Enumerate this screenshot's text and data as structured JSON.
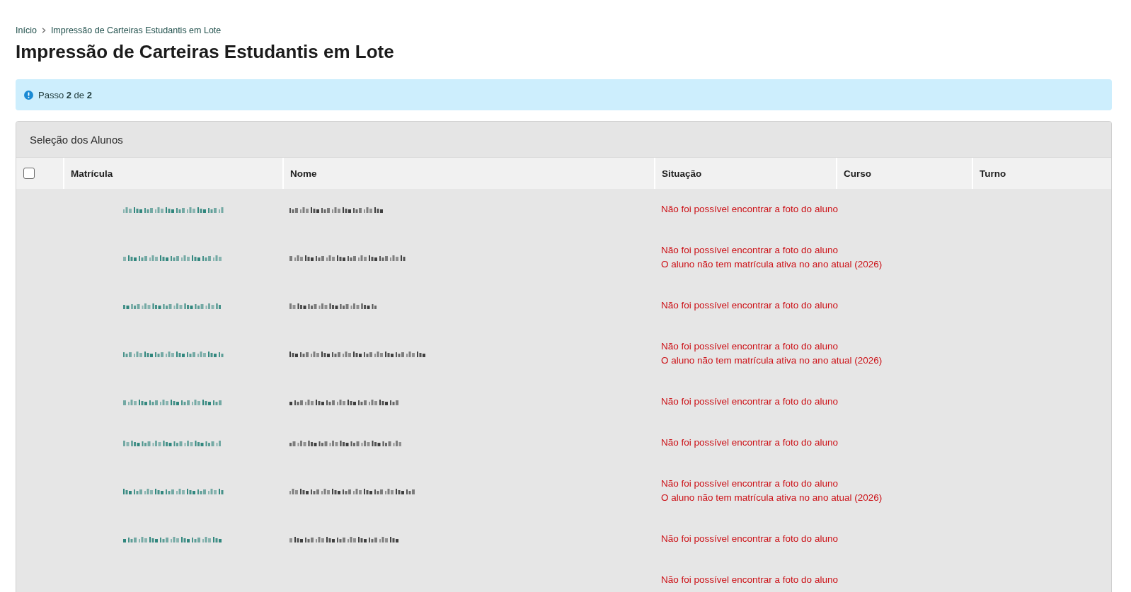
{
  "breadcrumb": [
    {
      "label": "Início"
    },
    {
      "label": "Impressão de Carteiras Estudantis em Lote"
    }
  ],
  "title": "Impressão de Carteiras Estudantis em Lote",
  "info": {
    "text": "Passo **2** de **2**"
  },
  "panel": {
    "title": "Seleção dos Alunos",
    "table": {
      "select_all": {
        "checked": false
      },
      "columns": [
        "Matrícula",
        "Nome",
        "Situação",
        "Curso",
        "Turno"
      ],
      "rows": [
        {
          "messages": [
            "Não foi possível encontrar a foto do aluno"
          ]
        },
        {
          "messages": [
            "Não foi possível encontrar a foto do aluno",
            "O aluno não tem matrícula ativa no ano atual (2026)"
          ]
        },
        {
          "messages": [
            "Não foi possível encontrar a foto do aluno"
          ]
        },
        {
          "messages": [
            "Não foi possível encontrar a foto do aluno",
            "O aluno não tem matrícula ativa no ano atual (2026)"
          ]
        },
        {
          "messages": [
            "Não foi possível encontrar a foto do aluno"
          ]
        },
        {
          "messages": [
            "Não foi possível encontrar a foto do aluno"
          ]
        },
        {
          "messages": [
            "Não foi possível encontrar a foto do aluno",
            "O aluno não tem matrícula ativa no ano atual (2026)"
          ]
        },
        {
          "messages": [
            "Não foi possível encontrar a foto do aluno"
          ]
        },
        {
          "messages": [
            "Não foi possível encontrar a foto do aluno"
          ]
        }
      ]
    }
  }
}
